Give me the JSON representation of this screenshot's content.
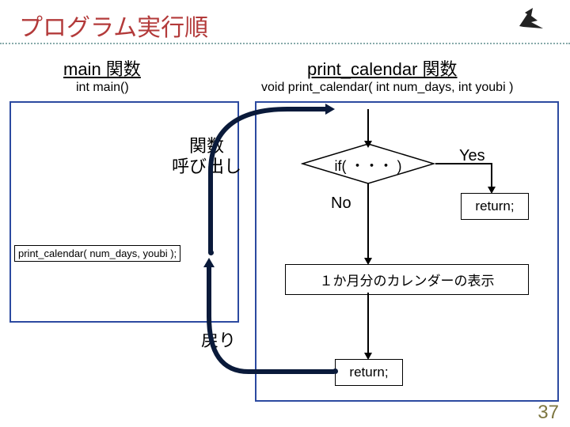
{
  "title": "プログラム実行順",
  "witch_caption": "",
  "left": {
    "header": "main 関数",
    "signature": "int main()",
    "call_code": "print_calendar( num_days, youbi );"
  },
  "right": {
    "header": "print_calendar 関数",
    "signature": "void print_calendar( int num_days, int youbi )",
    "diamond": "if( ・・・ )",
    "yes": "Yes",
    "no": "No",
    "ret1": "return;",
    "month_box": "１か月分のカレンダーの表示",
    "ret2": "return;"
  },
  "annotations": {
    "call": "関数\n呼び出し",
    "return": "戻り"
  },
  "page_number": "37"
}
